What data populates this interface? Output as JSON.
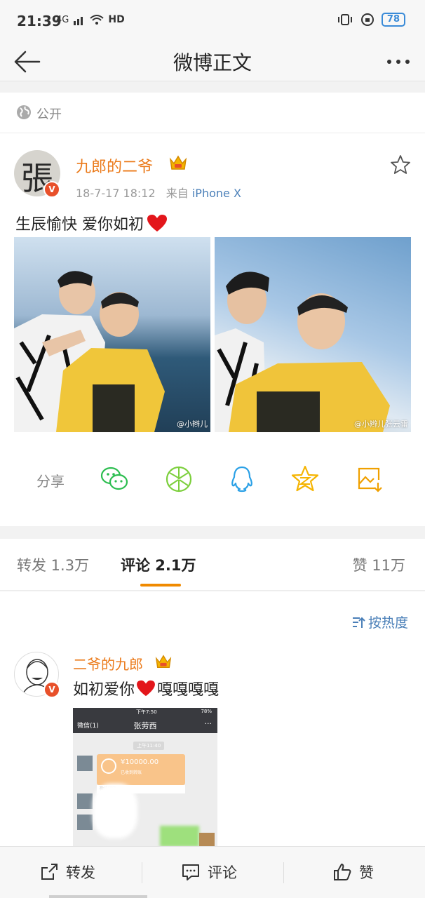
{
  "status_bar": {
    "time": "21:39",
    "network": "4G",
    "hd": "HD",
    "battery": "78"
  },
  "nav": {
    "title": "微博正文",
    "back_icon": "arrow-left-icon",
    "more_icon": "more-dots-icon"
  },
  "visibility": {
    "label": "公开",
    "icon": "globe-icon"
  },
  "post": {
    "avatar_letter": "張",
    "verified_badge": "V",
    "username": "九郎的二爷",
    "meta_time": "18-7-17 18:12",
    "meta_from": "来自",
    "meta_source": "iPhone X",
    "text": "生辰愉快 爱你如初",
    "photos": [
      {
        "watermark": "@小辫儿"
      },
      {
        "watermark": "@小辫儿张云雷"
      }
    ],
    "share": {
      "label": "分享",
      "targets": [
        "wechat-icon",
        "moments-icon",
        "qq-icon",
        "qzone-icon",
        "save-image-icon"
      ]
    }
  },
  "tabs": {
    "repost": "转发 1.3万",
    "comment": "评论 2.1万",
    "like": "赞 11万"
  },
  "comments": {
    "sort_label": "按热度",
    "items": [
      {
        "username": "二爷的九郎",
        "verified_badge": "V",
        "text": "如初爱你",
        "text_suffix": "嘎嘎嘎嘎",
        "screenshot": {
          "status_time": "下午7:50",
          "status_battery": "78%",
          "back": "微信(1)",
          "title": "张劳西",
          "dots": "···",
          "stamp": "上午11:40",
          "amount": "¥10000.00",
          "transfer_sub": "已收到转账",
          "transfer_foot": "微信转账"
        }
      }
    ]
  },
  "bottom_bar": {
    "repost": "转发",
    "comment": "评论",
    "like": "赞"
  },
  "colors": {
    "username": "#eb7a1a",
    "link": "#4a7fb8",
    "accent": "#f08a00",
    "battery": "#3a8bd8"
  }
}
